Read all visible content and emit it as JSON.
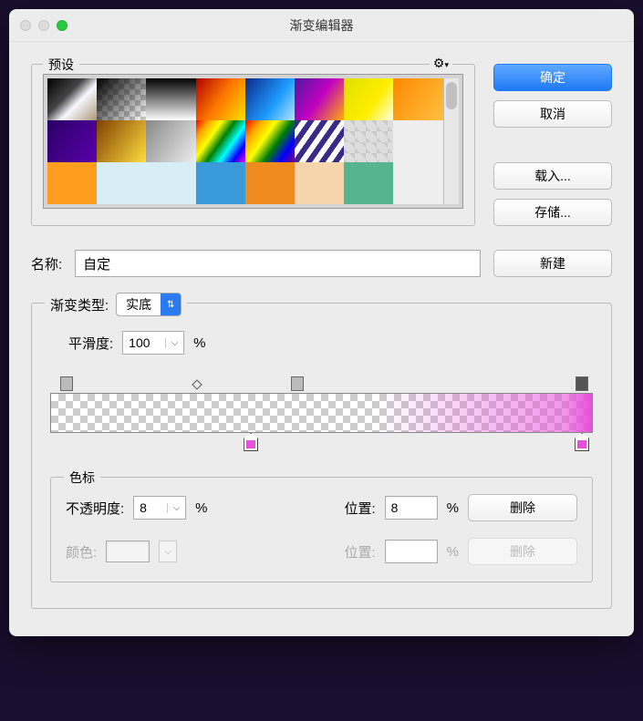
{
  "title": "渐变编辑器",
  "presets": {
    "legend": "预设"
  },
  "buttons": {
    "ok": "确定",
    "cancel": "取消",
    "load": "载入...",
    "save": "存储...",
    "new": "新建",
    "delete": "删除",
    "delete2": "删除"
  },
  "name": {
    "label": "名称:",
    "value": "自定"
  },
  "gradient": {
    "type_label": "渐变类型:",
    "type_value": "实底",
    "smooth_label": "平滑度:",
    "smooth_value": "100",
    "smooth_unit": "%"
  },
  "stops": {
    "legend": "色标",
    "opacity_label": "不透明度:",
    "opacity_value": "8",
    "opacity_unit": "%",
    "pos1_label": "位置:",
    "pos1_value": "8",
    "pos1_unit": "%",
    "color_label": "颜色:",
    "pos2_label": "位置:",
    "pos2_value": "",
    "pos2_unit": "%"
  },
  "opacity_stops": [
    {
      "pos": 3,
      "dark": false
    },
    {
      "pos": 45.5,
      "dark": false
    },
    {
      "pos": 98,
      "dark": true
    }
  ],
  "midpoints": [
    {
      "pos": 27
    }
  ],
  "color_stops": [
    {
      "pos": 37,
      "color": "#e850dc"
    },
    {
      "pos": 98,
      "color": "#e850dc"
    }
  ]
}
